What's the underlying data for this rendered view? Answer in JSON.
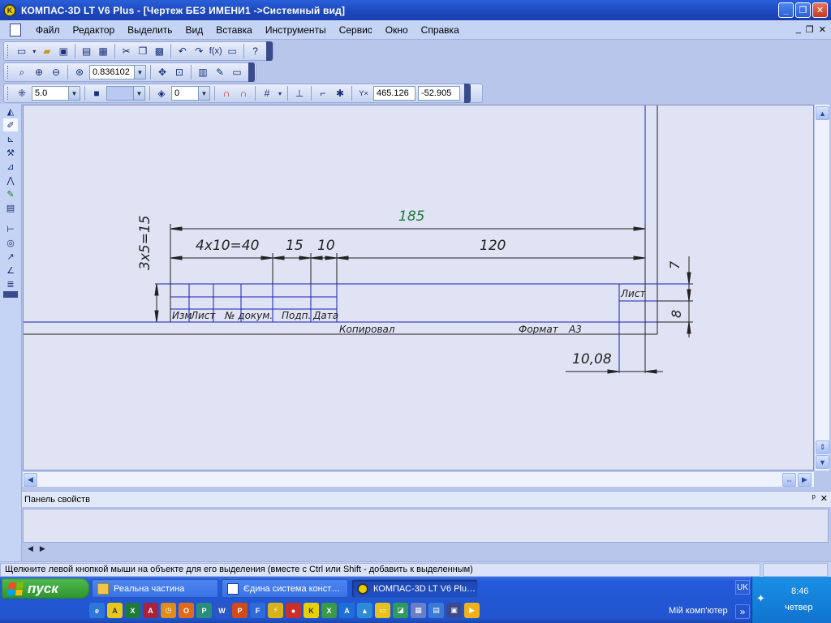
{
  "window": {
    "title": "КОМПАС-3D LT V6 Plus - [Чертеж БЕЗ ИМЕНИ1 ->Системный вид]",
    "buttons": {
      "minimize": "_",
      "maximize": "❐",
      "close": "✕"
    }
  },
  "menu": {
    "items": [
      {
        "label": "Файл",
        "key": "Ф"
      },
      {
        "label": "Редактор",
        "key": "Р"
      },
      {
        "label": "Выделить",
        "key": "В"
      },
      {
        "label": "Вид",
        "key": "и"
      },
      {
        "label": "Вставка",
        "key": "с"
      },
      {
        "label": "Инструменты",
        "key": "И"
      },
      {
        "label": "Сервис",
        "key": "С"
      },
      {
        "label": "Окно",
        "key": "О"
      },
      {
        "label": "Справка",
        "key": "п"
      }
    ],
    "mdi": {
      "minimize": "_",
      "restore": "❐",
      "close": "✕"
    }
  },
  "toolbar_view": {
    "zoom_value": "0.836102"
  },
  "toolbar_current": {
    "step_value": "5.0",
    "layer_value": "0",
    "coord_x": "465.126",
    "coord_y": "-52.905"
  },
  "drawing": {
    "dim_total": "185",
    "dim_rows": "4х10=40",
    "dim_15": "15",
    "dim_10": "10",
    "dim_120": "120",
    "dim_vertical": "3х5=15",
    "dim_7": "7",
    "dim_8": "8",
    "dim_1008": "10,08",
    "col_izm": "Изм",
    "col_list": "Лист",
    "col_docum": "№ докум.",
    "col_podp": "Подп.",
    "col_data": "Дата",
    "label_list": "Лист",
    "label_kopiroval": "Копировал",
    "label_format": "Формат",
    "label_a3": "А3"
  },
  "properties_panel": {
    "title": "Панель свойств",
    "pin": "ᵖ",
    "close": "✕"
  },
  "status": {
    "message": "Щелкните левой кнопкой мыши на объекте для его выделения (вместе с Ctrl или Shift - добавить к выделенным)"
  },
  "taskbar": {
    "start_label": "пуск",
    "tasks": [
      {
        "label": "Реальна частина"
      },
      {
        "label": "Єдина система конст…"
      },
      {
        "label": "КОМПАС-3D LT V6 Plu…"
      }
    ],
    "lang": "UK",
    "my_computer": "Мій комп'ютер",
    "time": "8:46",
    "day": "четвер"
  },
  "colors": {
    "drawing_line": "#1b1fb3",
    "dim_text_green": "#1e7a3a",
    "canvas_bg": "#dfe3f4"
  }
}
